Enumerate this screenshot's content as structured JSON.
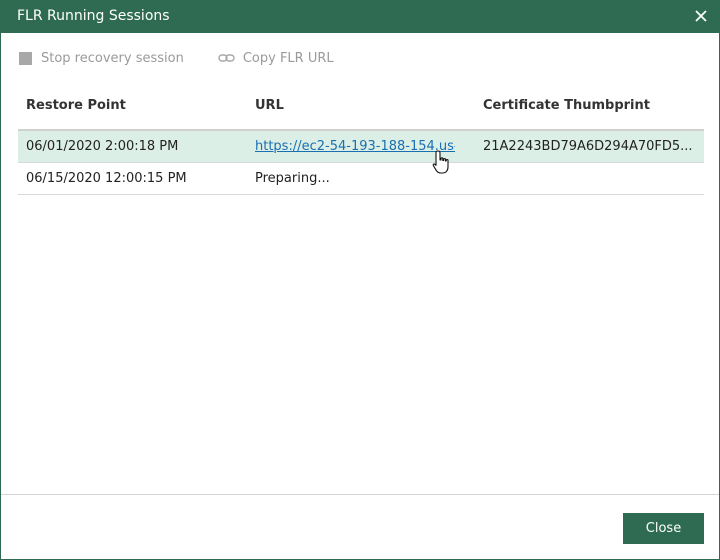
{
  "dialog": {
    "title": "FLR Running Sessions",
    "accent_color": "#2e6b52"
  },
  "toolbar": {
    "stop_label": "Stop recovery session",
    "copy_label": "Copy FLR URL"
  },
  "table": {
    "columns": [
      "Restore Point",
      "URL",
      "Certificate Thumbprint"
    ],
    "rows": [
      {
        "restore_point": "06/01/2020 2:00:18 PM",
        "url": "https://ec2-54-193-188-154.us-...",
        "thumbprint": "21A2243BD79A6D294A70FD5..."
      },
      {
        "restore_point": "06/15/2020 12:00:15 PM",
        "url": "Preparing...",
        "thumbprint": ""
      }
    ]
  },
  "footer": {
    "close_label": "Close"
  },
  "icons": {
    "close": "close-icon",
    "stop": "stop-square-icon",
    "copy": "link-icon",
    "cursor": "hand-pointer-icon"
  }
}
